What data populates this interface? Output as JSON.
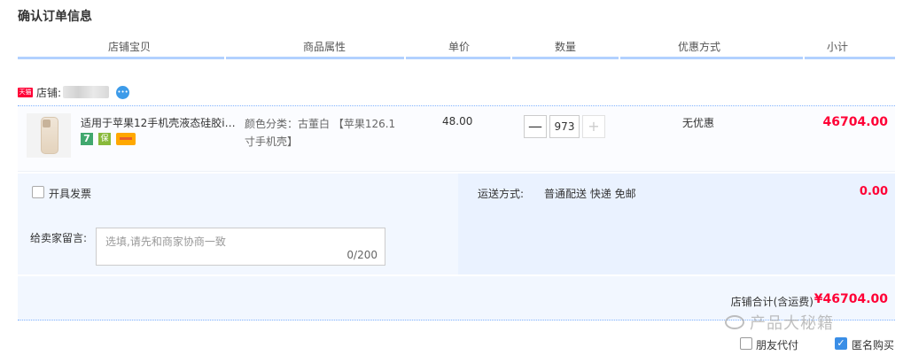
{
  "page_title": "确认订单信息",
  "columns": [
    "店铺宝贝",
    "商品属性",
    "单价",
    "数量",
    "优惠方式",
    "小计"
  ],
  "shop": {
    "badge": "天猫",
    "label": "店铺:",
    "ww_icon_text": "•••"
  },
  "item": {
    "title": "适用于苹果12手机壳液态硅胶ip...",
    "service_7": "7",
    "service_shield": "保",
    "attributes": "颜色分类：古董白 【苹果126.1寸手机壳】",
    "unit_price": "48.00",
    "quantity": {
      "minus": "—",
      "value": "973",
      "plus": "+"
    },
    "discount": "无优惠",
    "subtotal": "46704.00"
  },
  "options": {
    "invoice_label": "开具发票",
    "message_label": "给卖家留言:",
    "message_placeholder": "选填,请先和商家协商一致",
    "message_count": "0/200",
    "shipping_label": "运送方式:",
    "shipping_value": "普通配送 快递 免邮",
    "shipping_fee": "0.00"
  },
  "total": {
    "label": "店铺合计(含运费)",
    "value": "¥46704.00"
  },
  "watermark": "产品大秘籍",
  "checkboxes": {
    "friend_pay": {
      "label": "朋友代付",
      "checked": false
    },
    "anonymous": {
      "label": "匿名购买",
      "checked": true
    }
  },
  "colors": {
    "accent_red": "#ff0036",
    "header_line": "#b2d1ff",
    "panel_bg": "#f2f7ff"
  }
}
